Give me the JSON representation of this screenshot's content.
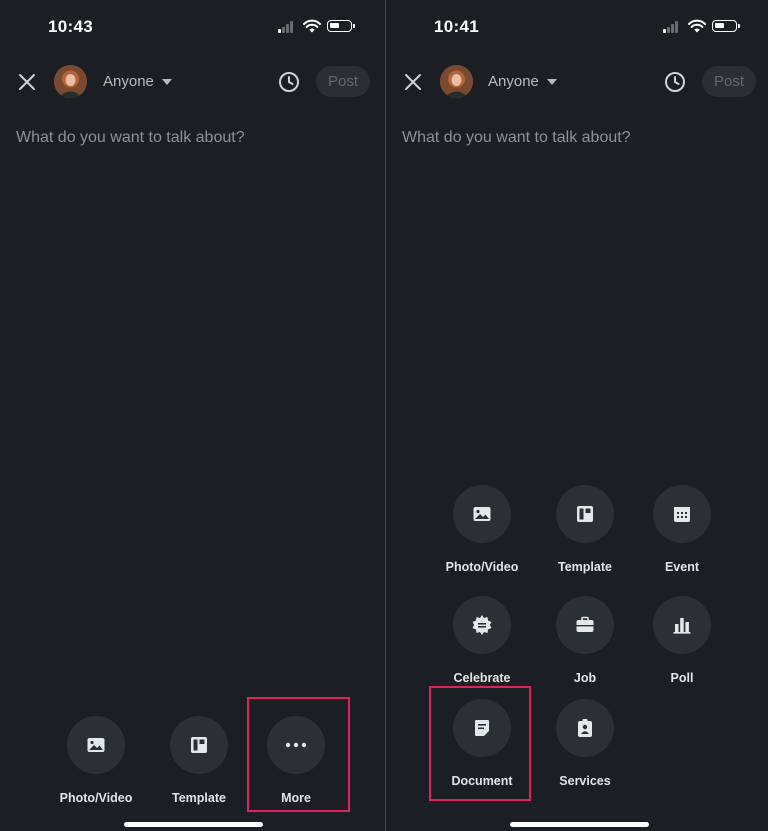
{
  "left": {
    "status": {
      "time": "10:43"
    },
    "header": {
      "audience": "Anyone",
      "post_label": "Post"
    },
    "composer": {
      "placeholder": "What do you want to talk about?"
    },
    "actions": [
      {
        "label": "Photo/Video",
        "icon": "image-icon"
      },
      {
        "label": "Template",
        "icon": "template-icon"
      },
      {
        "label": "More",
        "icon": "more-icon"
      }
    ],
    "highlighted": "More"
  },
  "right": {
    "status": {
      "time": "10:41"
    },
    "header": {
      "audience": "Anyone",
      "post_label": "Post"
    },
    "composer": {
      "placeholder": "What do you want to talk about?"
    },
    "actions": [
      {
        "label": "Photo/Video",
        "icon": "image-icon"
      },
      {
        "label": "Template",
        "icon": "template-icon"
      },
      {
        "label": "Event",
        "icon": "calendar-icon"
      },
      {
        "label": "Celebrate",
        "icon": "celebrate-icon"
      },
      {
        "label": "Job",
        "icon": "briefcase-icon"
      },
      {
        "label": "Poll",
        "icon": "poll-icon"
      },
      {
        "label": "Document",
        "icon": "document-icon"
      },
      {
        "label": "Services",
        "icon": "services-icon"
      }
    ],
    "highlighted": "Document"
  },
  "colors": {
    "background": "#1b1f23",
    "icon_circle": "#2b3036",
    "highlight": "#e2215a",
    "post_disabled": "#2b2f33"
  }
}
